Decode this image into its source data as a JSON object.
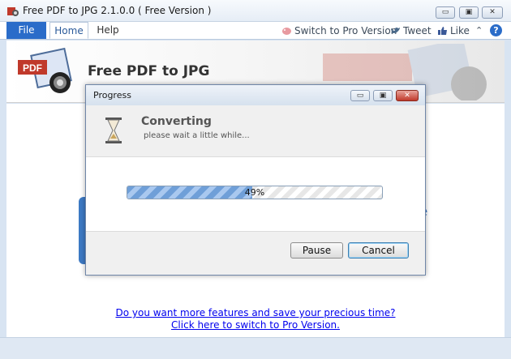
{
  "window": {
    "title": "Free PDF to JPG 2.1.0.0 ( Free Version )",
    "minimize_glyph": "▭",
    "maximize_glyph": "▣",
    "close_glyph": "✕"
  },
  "ribbon": {
    "file_label": "File",
    "tabs": [
      "Home",
      "Help"
    ],
    "switch_label": "Switch to Pro Version",
    "tweet_label": "Tweet",
    "like_label": "Like",
    "collapse_glyph": "⌃",
    "help_glyph": "?"
  },
  "banner": {
    "title": "Free PDF to JPG",
    "logo_text": "PDF"
  },
  "content": {
    "blue_text": "e",
    "promo_line1": "Do you want more features and save your precious time?",
    "promo_line2": "Click here to switch to Pro Version."
  },
  "dialog": {
    "title": "Progress",
    "heading": "Converting",
    "subtext": "please wait a little while...",
    "progress_percent": 49,
    "progress_label": "49%",
    "pause_label": "Pause",
    "cancel_label": "Cancel"
  },
  "colors": {
    "accent": "#2a6cc9",
    "progress_fill": "#6f9fd8",
    "link": "#0000ee"
  }
}
